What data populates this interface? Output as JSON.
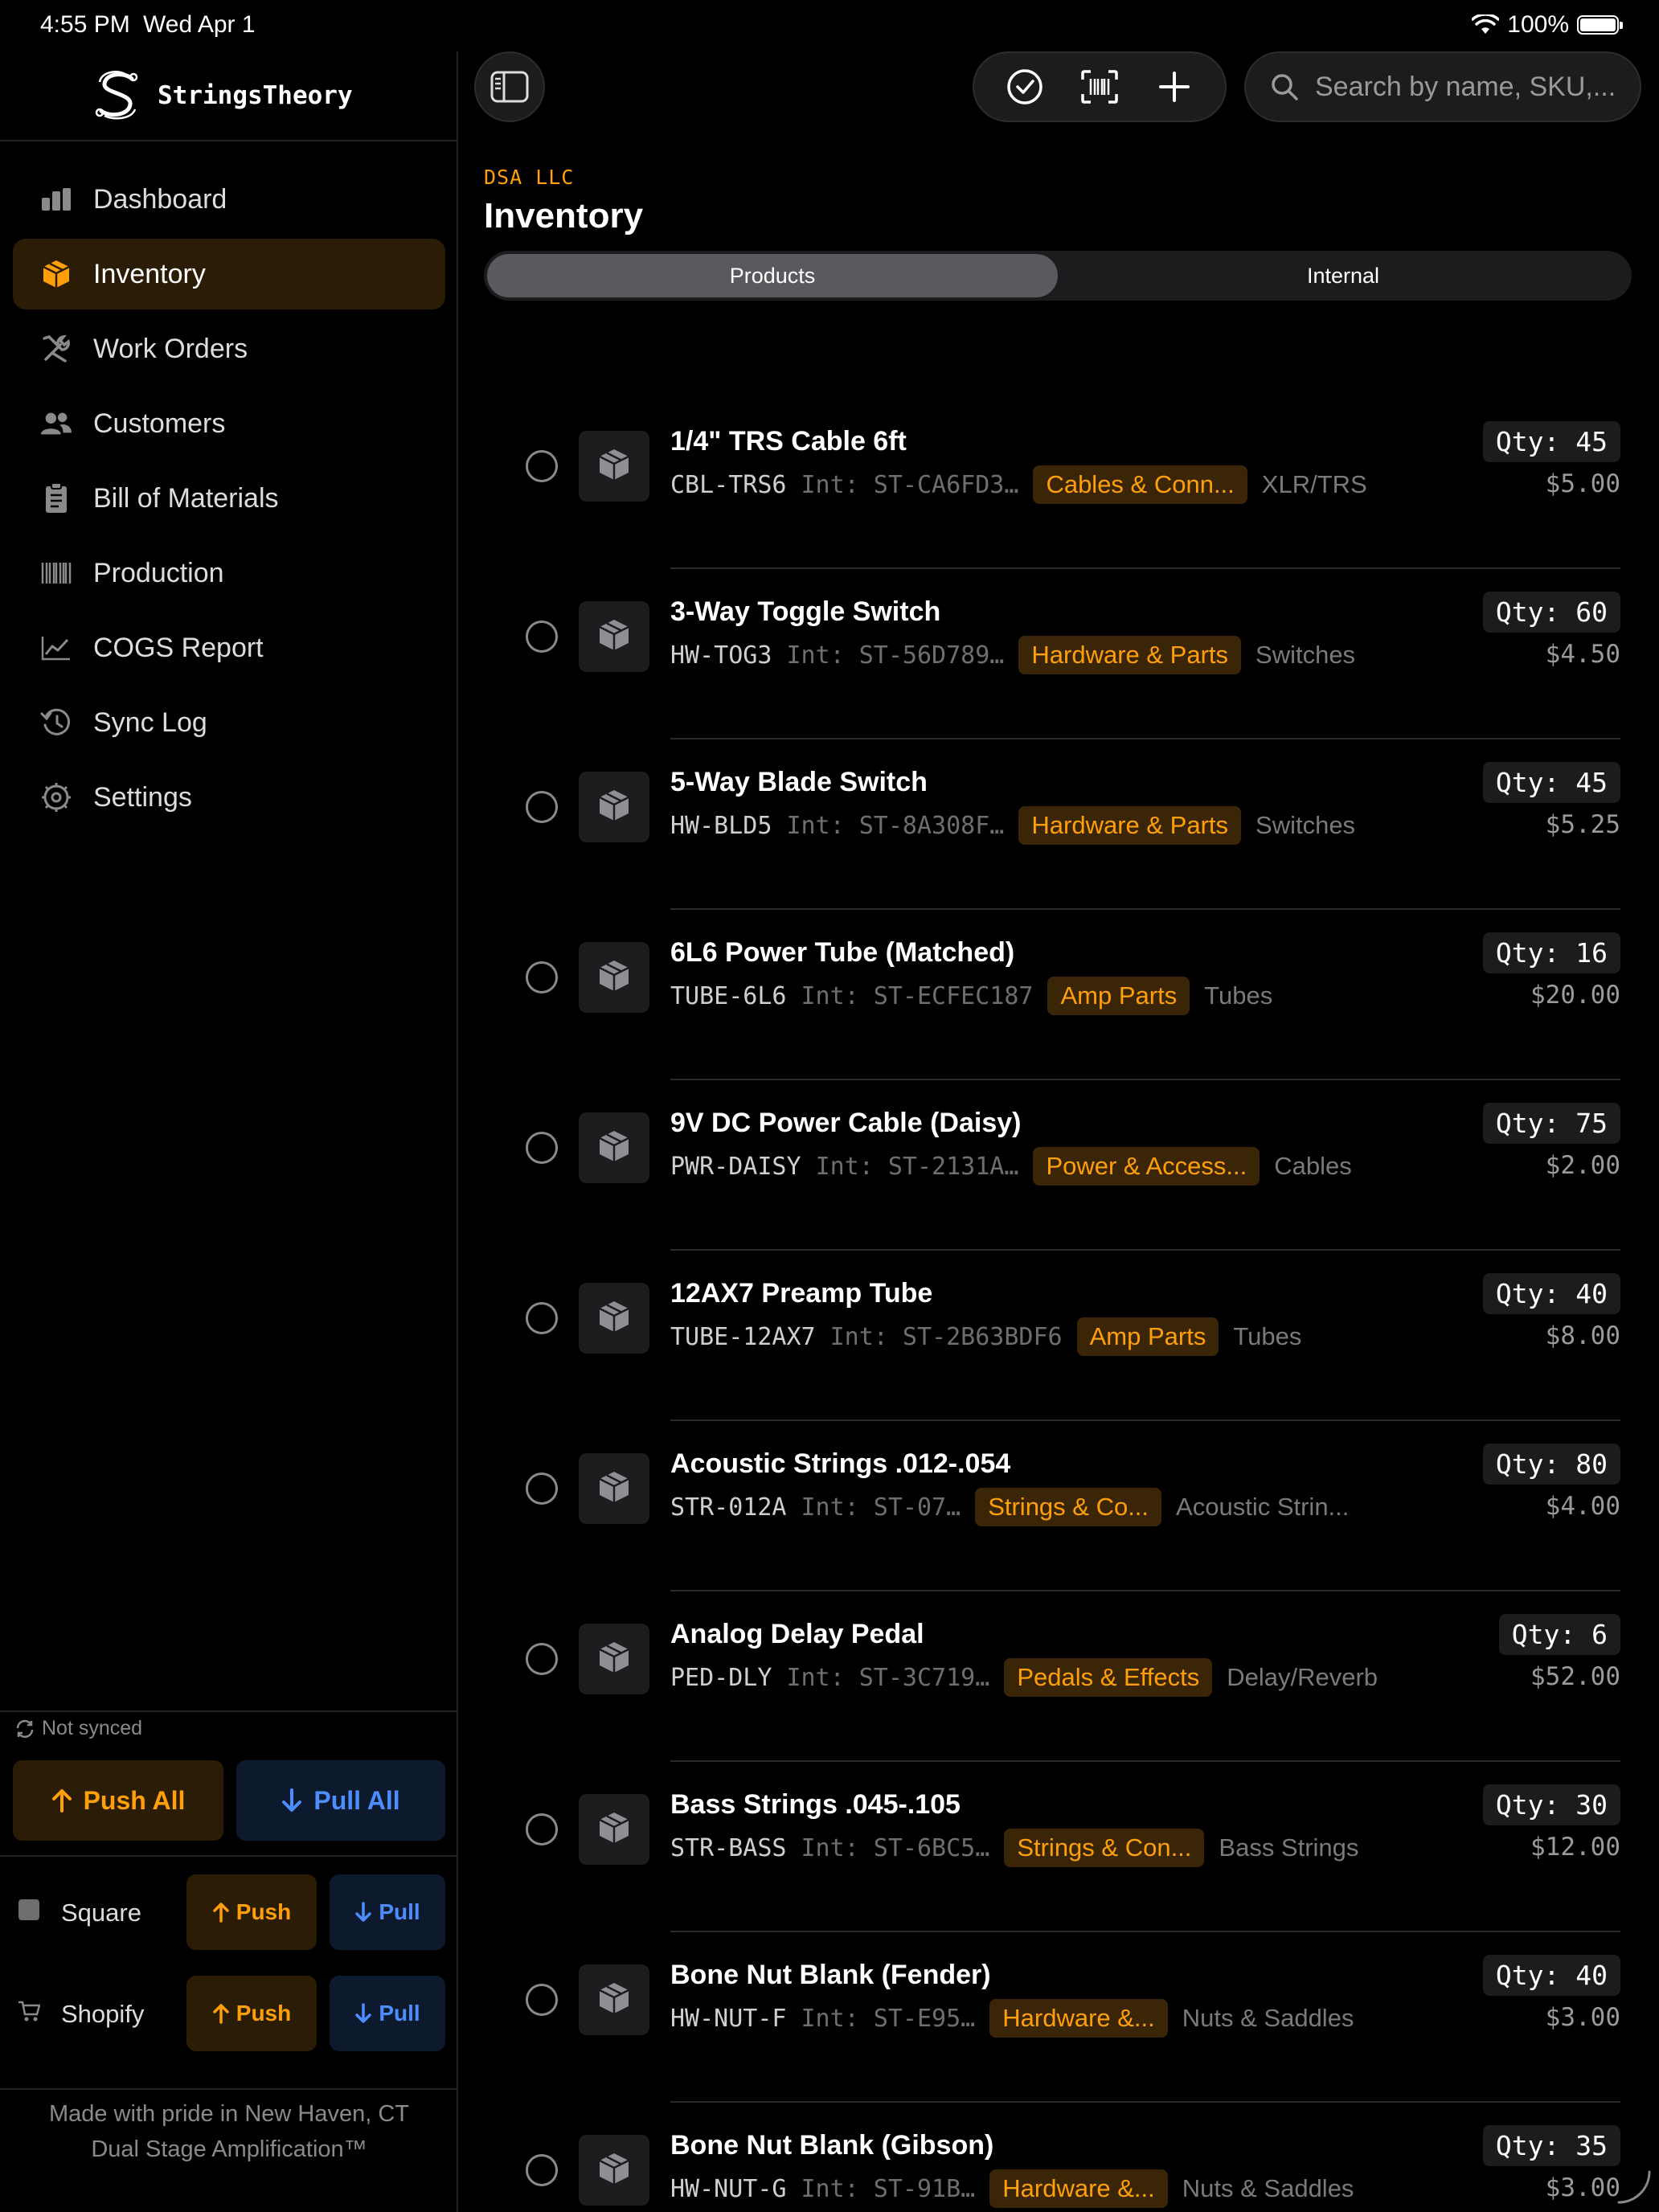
{
  "status_bar": {
    "time": "4:55 PM",
    "date": "Wed Apr 1",
    "battery": "100%"
  },
  "app": {
    "name": "StringsTheory"
  },
  "nav": [
    {
      "label": "Dashboard",
      "icon": "chart-bar-icon"
    },
    {
      "label": "Inventory",
      "icon": "box-icon",
      "active": true
    },
    {
      "label": "Work Orders",
      "icon": "tools-icon"
    },
    {
      "label": "Customers",
      "icon": "people-icon"
    },
    {
      "label": "Bill of Materials",
      "icon": "clipboard-icon"
    },
    {
      "label": "Production",
      "icon": "barcode-icon"
    },
    {
      "label": "COGS Report",
      "icon": "line-chart-icon"
    },
    {
      "label": "Sync Log",
      "icon": "history-icon"
    },
    {
      "label": "Settings",
      "icon": "gear-icon"
    }
  ],
  "sync": {
    "status": "Not synced",
    "push_all": "Push All",
    "pull_all": "Pull All",
    "integrations": [
      {
        "name": "Square",
        "push": "Push",
        "pull": "Pull"
      },
      {
        "name": "Shopify",
        "push": "Push",
        "pull": "Pull"
      }
    ]
  },
  "footer": {
    "line1": "Made with pride in New Haven, CT",
    "line2": "Dual Stage Amplification™"
  },
  "search": {
    "placeholder": "Search by name, SKU,..."
  },
  "header": {
    "company": "DSA LLC",
    "title": "Inventory"
  },
  "segments": {
    "products": "Products",
    "internal": "Internal"
  },
  "colors": {
    "accent": "#ff9f0a",
    "blue": "#4c8dff",
    "background": "#000000"
  },
  "items": [
    {
      "name": "1/4\" TRS Cable 6ft",
      "sku": "CBL-TRS6",
      "internal": "Int: ST-CA6FD3…",
      "category": "Cables & Conn...",
      "sub": "XLR/TRS",
      "qty": "Qty: 45",
      "price": "$5.00"
    },
    {
      "name": "3-Way Toggle Switch",
      "sku": "HW-TOG3",
      "internal": "Int: ST-56D789…",
      "category": "Hardware & Parts",
      "sub": "Switches",
      "qty": "Qty: 60",
      "price": "$4.50"
    },
    {
      "name": "5-Way Blade Switch",
      "sku": "HW-BLD5",
      "internal": "Int: ST-8A308F…",
      "category": "Hardware & Parts",
      "sub": "Switches",
      "qty": "Qty: 45",
      "price": "$5.25"
    },
    {
      "name": "6L6 Power Tube (Matched)",
      "sku": "TUBE-6L6",
      "internal": "Int: ST-ECFEC187",
      "category": "Amp Parts",
      "sub": "Tubes",
      "qty": "Qty: 16",
      "price": "$20.00"
    },
    {
      "name": "9V DC Power Cable (Daisy)",
      "sku": "PWR-DAISY",
      "internal": "Int: ST-2131A…",
      "category": "Power & Access...",
      "sub": "Cables",
      "qty": "Qty: 75",
      "price": "$2.00"
    },
    {
      "name": "12AX7 Preamp Tube",
      "sku": "TUBE-12AX7",
      "internal": "Int: ST-2B63BDF6",
      "category": "Amp Parts",
      "sub": "Tubes",
      "qty": "Qty: 40",
      "price": "$8.00"
    },
    {
      "name": "Acoustic Strings .012-.054",
      "sku": "STR-012A",
      "internal": "Int: ST-07…",
      "category": "Strings & Co...",
      "sub": "Acoustic Strin...",
      "qty": "Qty: 80",
      "price": "$4.00"
    },
    {
      "name": "Analog Delay Pedal",
      "sku": "PED-DLY",
      "internal": "Int: ST-3C719…",
      "category": "Pedals & Effects",
      "sub": "Delay/Reverb",
      "qty": "Qty: 6",
      "price": "$52.00"
    },
    {
      "name": "Bass Strings .045-.105",
      "sku": "STR-BASS",
      "internal": "Int: ST-6BC5…",
      "category": "Strings & Con...",
      "sub": "Bass Strings",
      "qty": "Qty: 30",
      "price": "$12.00"
    },
    {
      "name": "Bone Nut Blank (Fender)",
      "sku": "HW-NUT-F",
      "internal": "Int: ST-E95…",
      "category": "Hardware &...",
      "sub": "Nuts & Saddles",
      "qty": "Qty: 40",
      "price": "$3.00"
    },
    {
      "name": "Bone Nut Blank (Gibson)",
      "sku": "HW-NUT-G",
      "internal": "Int: ST-91B…",
      "category": "Hardware &...",
      "sub": "Nuts & Saddles",
      "qty": "Qty: 35",
      "price": "$3.00"
    }
  ]
}
